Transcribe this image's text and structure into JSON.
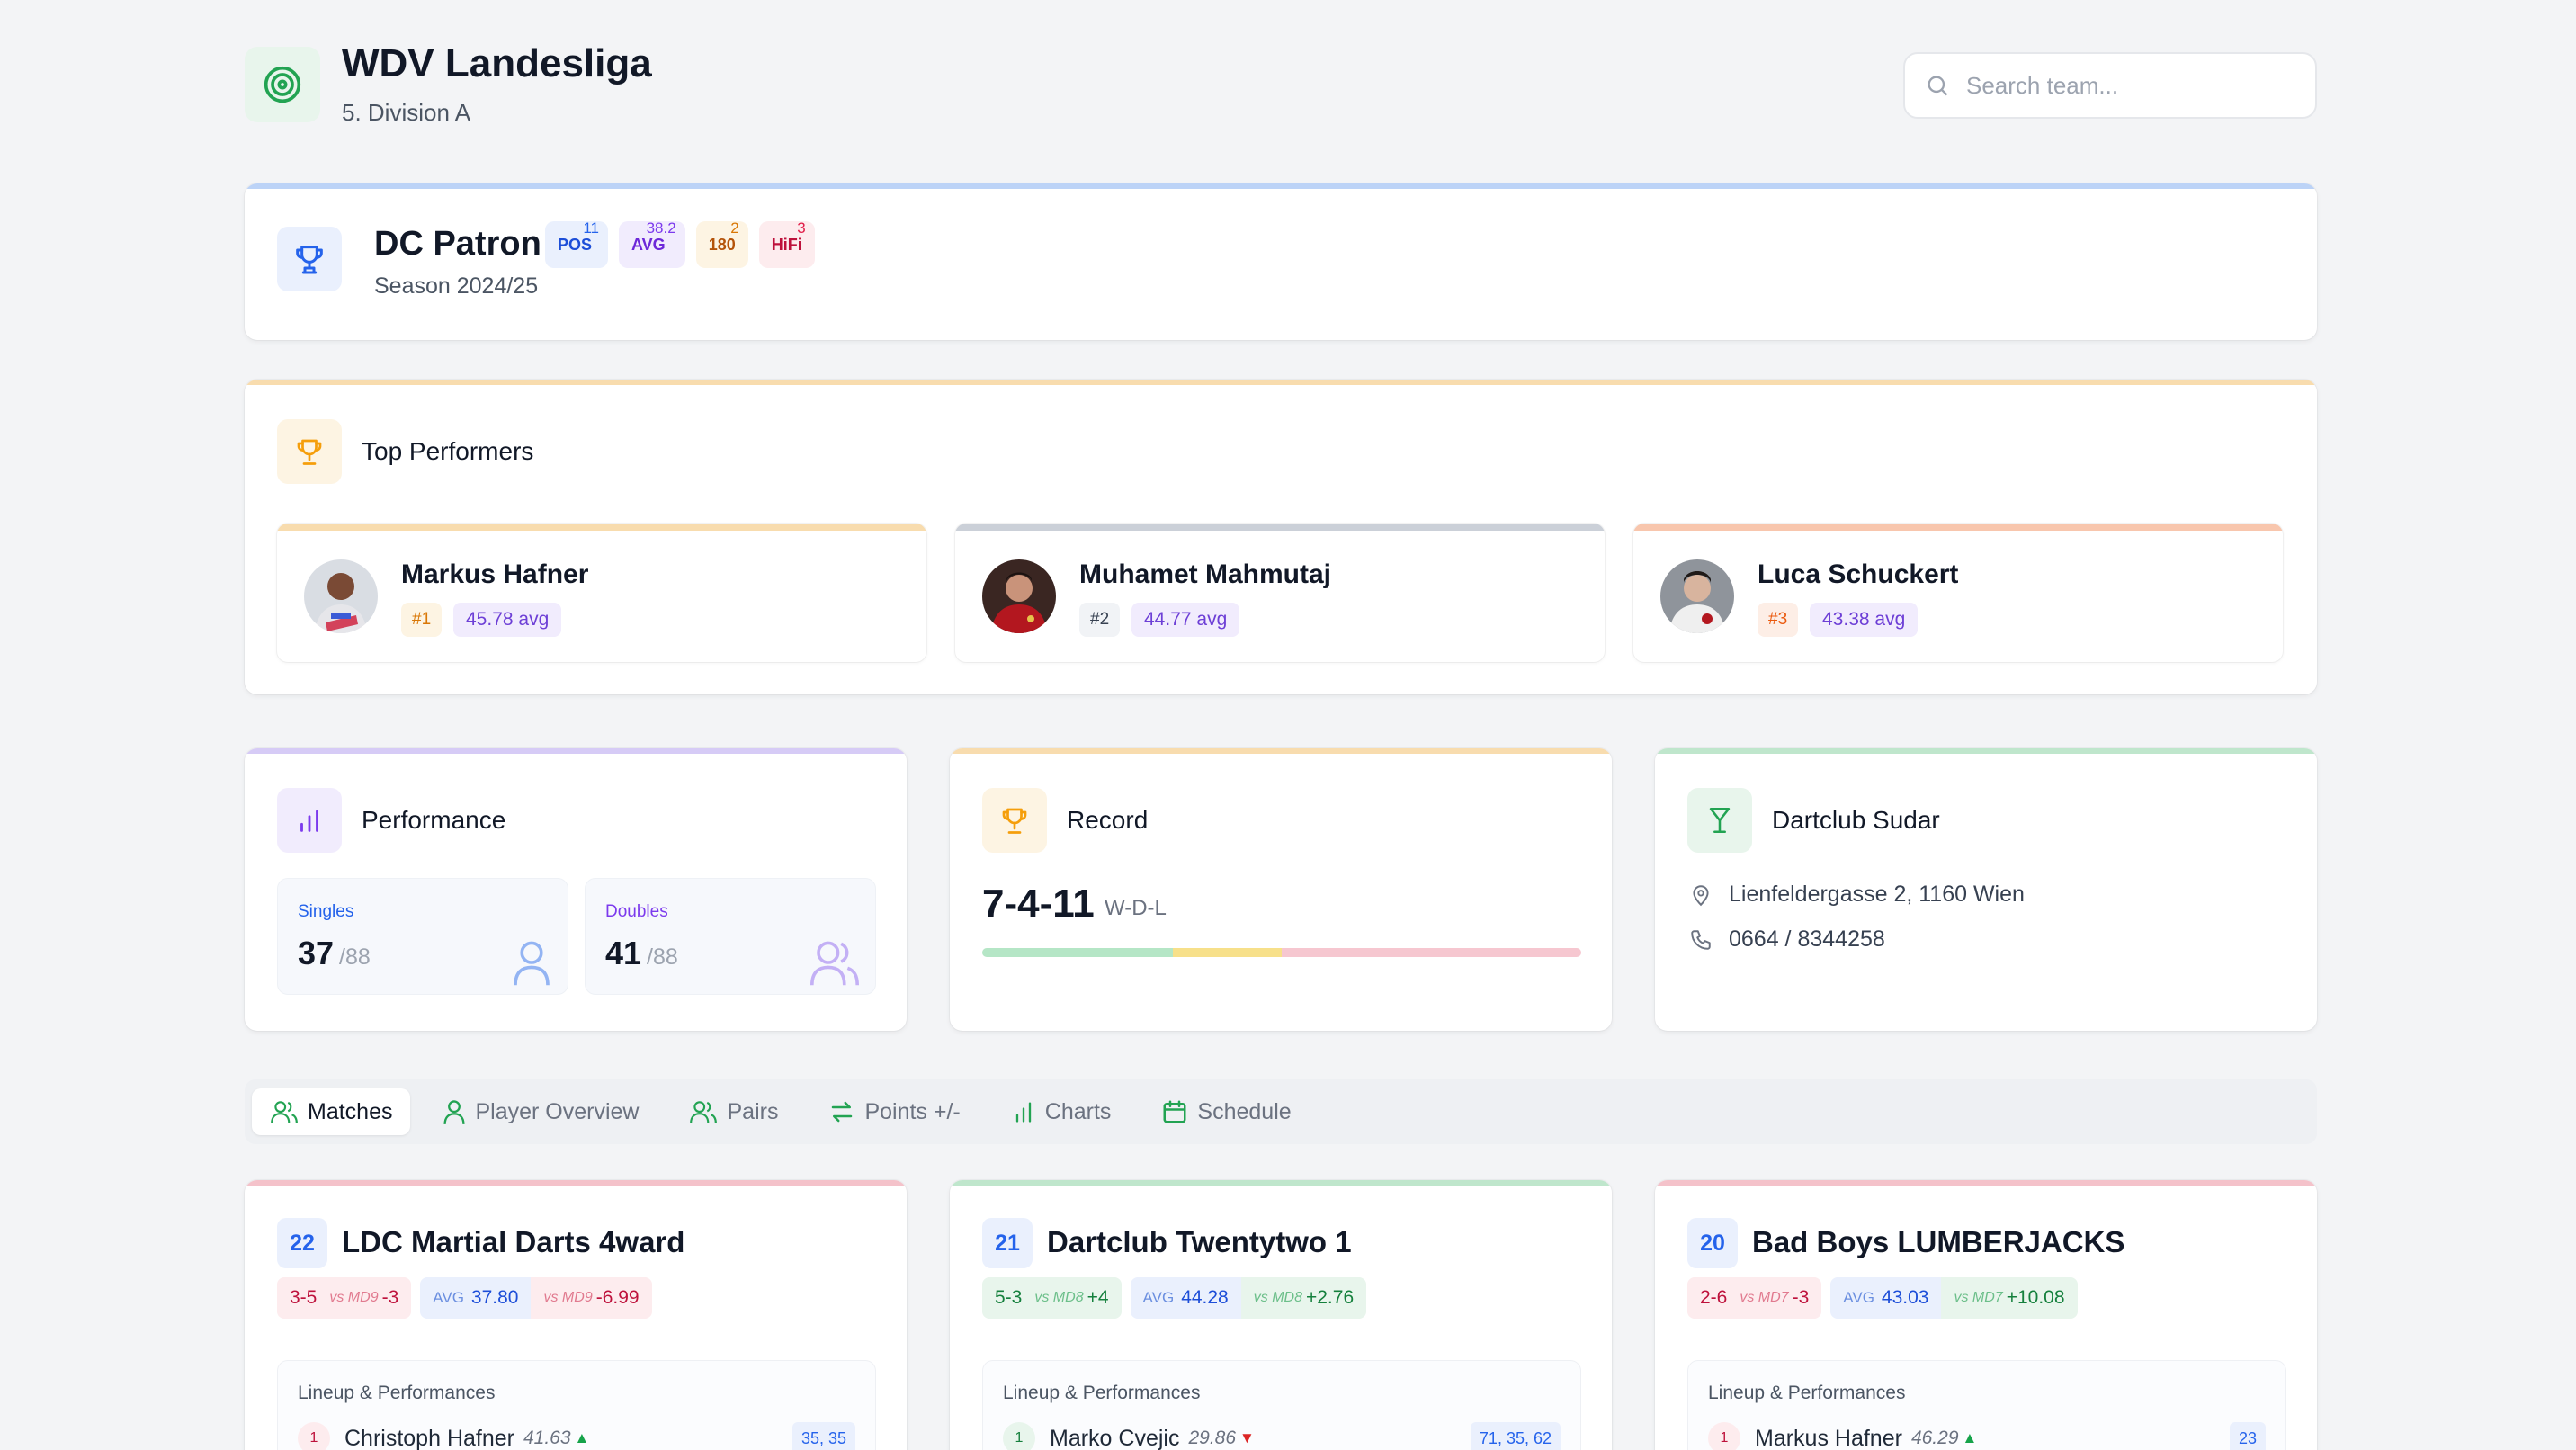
{
  "header": {
    "title": "WDV Landesliga",
    "subtitle": "5. Division A",
    "search_placeholder": "Search team..."
  },
  "team": {
    "name": "DC Patron",
    "season": "Season 2024/25",
    "badges": [
      {
        "label": "POS",
        "count": "11"
      },
      {
        "label": "AVG",
        "count": "38.2"
      },
      {
        "label": "180",
        "count": "2"
      },
      {
        "label": "HiFi",
        "count": "3"
      }
    ]
  },
  "top_performers": {
    "title": "Top Performers",
    "players": [
      {
        "name": "Markus Hafner",
        "rank": "#1",
        "avg": "45.78 avg"
      },
      {
        "name": "Muhamet Mahmutaj",
        "rank": "#2",
        "avg": "44.77 avg"
      },
      {
        "name": "Luca Schuckert",
        "rank": "#3",
        "avg": "43.38 avg"
      }
    ]
  },
  "performance": {
    "title": "Performance",
    "singles_label": "Singles",
    "singles_value": "37",
    "singles_total": "/88",
    "doubles_label": "Doubles",
    "doubles_value": "41",
    "doubles_total": "/88"
  },
  "record": {
    "title": "Record",
    "value": "7-4-11",
    "label": "W-D-L",
    "wins": 7,
    "draws": 4,
    "losses": 11
  },
  "venue": {
    "title": "Dartclub Sudar",
    "address": "Lienfeldergasse 2, 1160 Wien",
    "phone": "0664 / 8344258"
  },
  "tabs": [
    "Matches",
    "Player Overview",
    "Pairs",
    "Points +/-",
    "Charts",
    "Schedule"
  ],
  "matches": [
    {
      "md": "22",
      "opponent": "LDC Martial Darts 4ward",
      "score": "3-5",
      "score_vs": "vs MD9",
      "score_delta": "-3",
      "avg_label": "AVG",
      "avg": "37.80",
      "avg_vs": "vs MD9",
      "avg_delta": "-6.99",
      "lineup_label": "Lineup & Performances",
      "first_player": {
        "idx": "1",
        "name": "Christoph Hafner",
        "avg": "41.63",
        "trend": "▲",
        "legs": "35, 35"
      }
    },
    {
      "md": "21",
      "opponent": "Dartclub Twentytwo 1",
      "score": "5-3",
      "score_vs": "vs MD8",
      "score_delta": "+4",
      "avg_label": "AVG",
      "avg": "44.28",
      "avg_vs": "vs MD8",
      "avg_delta": "+2.76",
      "lineup_label": "Lineup & Performances",
      "first_player": {
        "idx": "1",
        "name": "Marko Cvejic",
        "avg": "29.86",
        "trend": "▼",
        "legs": "71, 35, 62"
      }
    },
    {
      "md": "20",
      "opponent": "Bad Boys LUMBERJACKS",
      "score": "2-6",
      "score_vs": "vs MD7",
      "score_delta": "-3",
      "avg_label": "AVG",
      "avg": "43.03",
      "avg_vs": "vs MD7",
      "avg_delta": "+10.08",
      "lineup_label": "Lineup & Performances",
      "first_player": {
        "idx": "1",
        "name": "Markus Hafner",
        "avg": "46.29",
        "trend": "▲",
        "legs": "23"
      }
    }
  ],
  "colors": {
    "accent_blue": "#2563eb",
    "green": "#16a34a",
    "red": "#dc2626",
    "purple": "#7c3aed",
    "amber": "#f59e0b"
  }
}
